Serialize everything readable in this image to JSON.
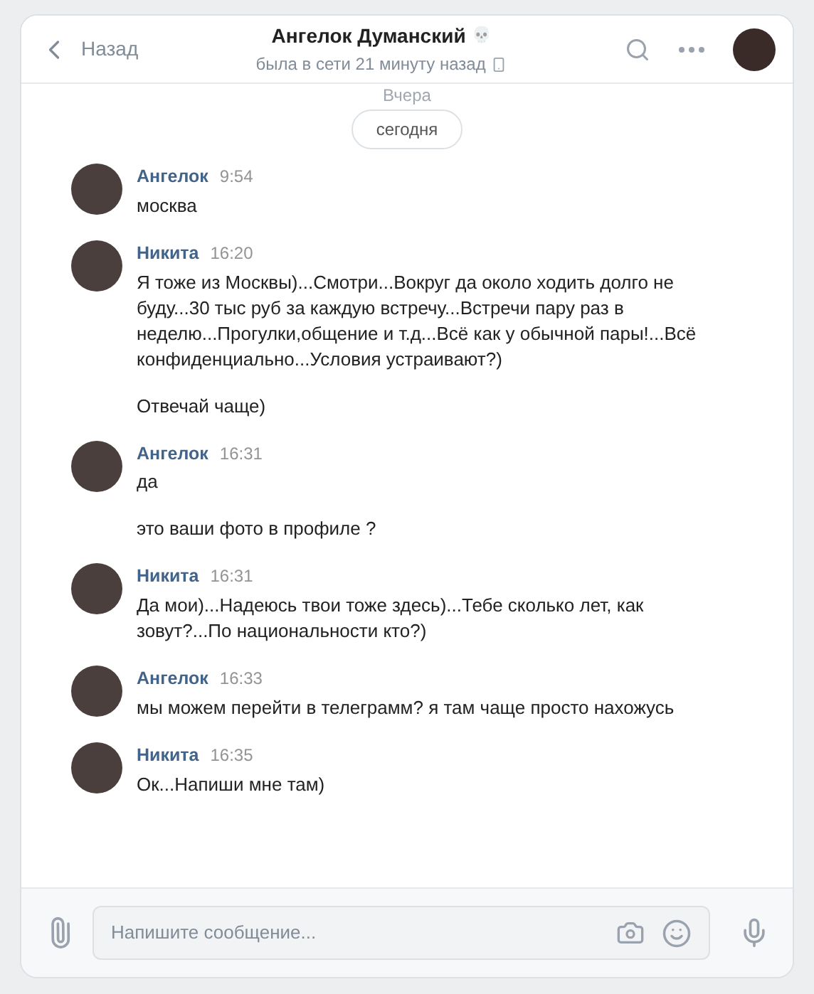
{
  "header": {
    "back": "Назад",
    "title": "Ангелок Думанский",
    "title_emoji": "💀",
    "status": "была в сети 21 минуту назад"
  },
  "earlier_divider": "Вчера",
  "date_badge": "сегодня",
  "groups": [
    {
      "author": "Ангелок",
      "time": "9:54",
      "messages": [
        "москва"
      ]
    },
    {
      "author": "Никита",
      "time": "16:20",
      "messages": [
        "Я тоже из Москвы)...Смотри...Вокруг да около ходить долго не буду...30 тыс руб за каждую встречу...Встречи пару раз в неделю...Прогулки,общение и т.д...Всё как у обычной пары!...Всё конфиденциально...Условия устраивают?)",
        "Отвечай чаще)"
      ]
    },
    {
      "author": "Ангелок",
      "time": "16:31",
      "messages": [
        "да",
        "это ваши фото в профиле ?"
      ]
    },
    {
      "author": "Никита",
      "time": "16:31",
      "messages": [
        "Да мои)...Надеюсь твои тоже здесь)...Тебе сколько лет, как зовут?...По национальности кто?)"
      ]
    },
    {
      "author": "Ангелок",
      "time": "16:33",
      "messages": [
        "мы можем перейти в телеграмм? я там чаще просто нахожусь"
      ]
    },
    {
      "author": "Никита",
      "time": "16:35",
      "messages": [
        "Ок...Напиши мне там)"
      ]
    }
  ],
  "composer": {
    "placeholder": "Напишите сообщение..."
  }
}
